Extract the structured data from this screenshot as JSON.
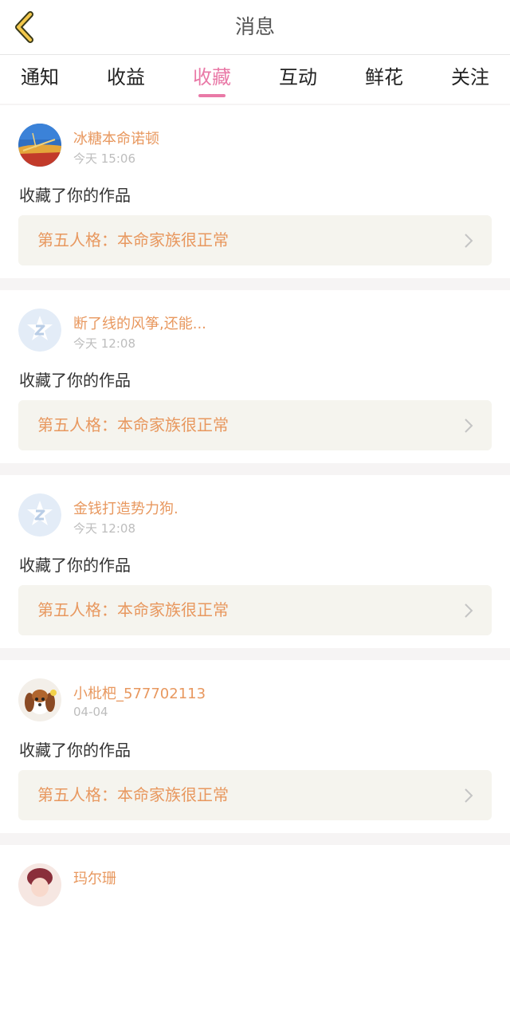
{
  "header": {
    "title": "消息",
    "back_icon": "chevron-left-icon",
    "back_color": "#f3c84b"
  },
  "tabs": [
    {
      "label": "通知",
      "active": false
    },
    {
      "label": "收益",
      "active": false
    },
    {
      "label": "收藏",
      "active": true
    },
    {
      "label": "互动",
      "active": false
    },
    {
      "label": "鲜花",
      "active": false
    },
    {
      "label": "关注",
      "active": false
    }
  ],
  "colors": {
    "accent": "#e979a7",
    "username": "#e8985f",
    "work_bg": "#f5f4ee"
  },
  "notifications": [
    {
      "username": "冰糖本命诺顿",
      "time": "今天 15:06",
      "action": "收藏了你的作品",
      "work_title": "第五人格：本命家族很正常",
      "avatar": "landscape-avatar"
    },
    {
      "username": "断了线的风筝,还能...",
      "time": "今天 12:08",
      "action": "收藏了你的作品",
      "work_title": "第五人格：本命家族很正常",
      "avatar": "default-z-avatar"
    },
    {
      "username": "金钱打造势力狗.",
      "time": "今天 12:08",
      "action": "收藏了你的作品",
      "work_title": "第五人格：本命家族很正常",
      "avatar": "default-z-avatar"
    },
    {
      "username": "小枇杷_577702113",
      "time": "04-04",
      "action": "收藏了你的作品",
      "work_title": "第五人格：本命家族很正常",
      "avatar": "dog-avatar"
    },
    {
      "username": "玛尔珊",
      "time": "",
      "action": "",
      "work_title": "",
      "avatar": "girl-avatar"
    }
  ]
}
